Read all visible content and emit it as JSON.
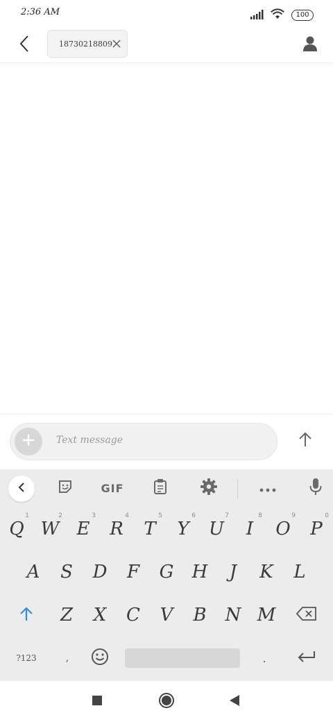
{
  "status_bar": {
    "time": "2:36 AM",
    "battery": "100"
  },
  "header": {
    "recipient": "18730218809"
  },
  "compose": {
    "placeholder": "Text message"
  },
  "keyboard": {
    "toolbar": {
      "gif_label": "GIF"
    },
    "row1": [
      {
        "label": "Q",
        "hint": "1"
      },
      {
        "label": "W",
        "hint": "2"
      },
      {
        "label": "E",
        "hint": "3"
      },
      {
        "label": "R",
        "hint": "4"
      },
      {
        "label": "T",
        "hint": "5"
      },
      {
        "label": "Y",
        "hint": "6"
      },
      {
        "label": "U",
        "hint": "7"
      },
      {
        "label": "I",
        "hint": "8"
      },
      {
        "label": "O",
        "hint": "9"
      },
      {
        "label": "P",
        "hint": "0"
      }
    ],
    "row2": [
      "A",
      "S",
      "D",
      "F",
      "G",
      "H",
      "J",
      "K",
      "L"
    ],
    "row3": [
      "Z",
      "X",
      "C",
      "V",
      "B",
      "N",
      "M"
    ],
    "bottom": {
      "symbols_label": "?123",
      "comma_label": ",",
      "period_label": "."
    },
    "colors": {
      "shift_accent": "#2f8fe6"
    }
  }
}
